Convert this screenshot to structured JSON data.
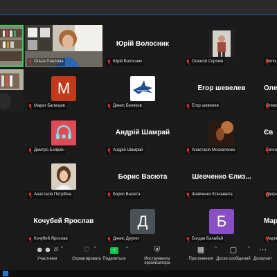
{
  "participants": [
    {
      "name": "Ольга Паплова",
      "type": "video",
      "big": ""
    },
    {
      "name": "Юрій Волосник",
      "type": "name",
      "big": "Юрій Волосник"
    },
    {
      "name": "Олексій Сорокін",
      "type": "photo",
      "big": ""
    },
    {
      "name": "Denis Zh",
      "type": "partial",
      "big": ""
    },
    {
      "name": "",
      "type": "video2",
      "big": ""
    },
    {
      "name": "Марат Балещев",
      "type": "avatar",
      "letter": "М",
      "color": "#c33a1b",
      "big": ""
    },
    {
      "name": "Денис Беляков",
      "type": "shark",
      "big": ""
    },
    {
      "name": "Егор шевелев",
      "type": "name",
      "big": "Егор шевелев"
    },
    {
      "name": "Олександ",
      "type": "name",
      "big": "Оле"
    },
    {
      "name": "Дмитро Бояркін",
      "type": "headphones",
      "big": ""
    },
    {
      "name": "Андрій Шамрай",
      "type": "name",
      "big": "Андрій Шамрай"
    },
    {
      "name": "Анастасія Москаленко",
      "type": "photo2",
      "big": ""
    },
    {
      "name": "Евген Со",
      "type": "name",
      "big": "Єв"
    },
    {
      "name": "Анастасія Потрібна",
      "type": "girl",
      "big": ""
    },
    {
      "name": "Борис Васюта",
      "type": "name",
      "big": "Борис Васюта"
    },
    {
      "name": "Шевченко Єлизавета",
      "type": "name",
      "big": "Шевченко Єлиз..."
    },
    {
      "name": "Дворниче",
      "type": "name",
      "big": ""
    },
    {
      "name": "Кочубей Ярослав",
      "type": "name",
      "big": "Кочубей Ярослав"
    },
    {
      "name": "Денис Деулет",
      "type": "avatar",
      "letter": "Д",
      "color": "#4a5157",
      "big": ""
    },
    {
      "name": "Богдан Балабай",
      "type": "avatar",
      "letter": "Б",
      "color": "#8a4fc4",
      "big": ""
    },
    {
      "name": "Марія Кр",
      "type": "name",
      "big": "Мар"
    }
  ],
  "toolbar": {
    "participants_label": "Участники",
    "participants_count": "25",
    "react_label": "Отреагировать",
    "share_label": "Поделиться",
    "host_tools_label": "Инструменты организатора",
    "apps_label": "Приложения",
    "whiteboard_label": "Доски сообщений",
    "more_label": "Дополнит"
  },
  "colors": {
    "active_speaker": "#23d959",
    "share_green": "#19c24f",
    "mic_off": "#e02828"
  }
}
